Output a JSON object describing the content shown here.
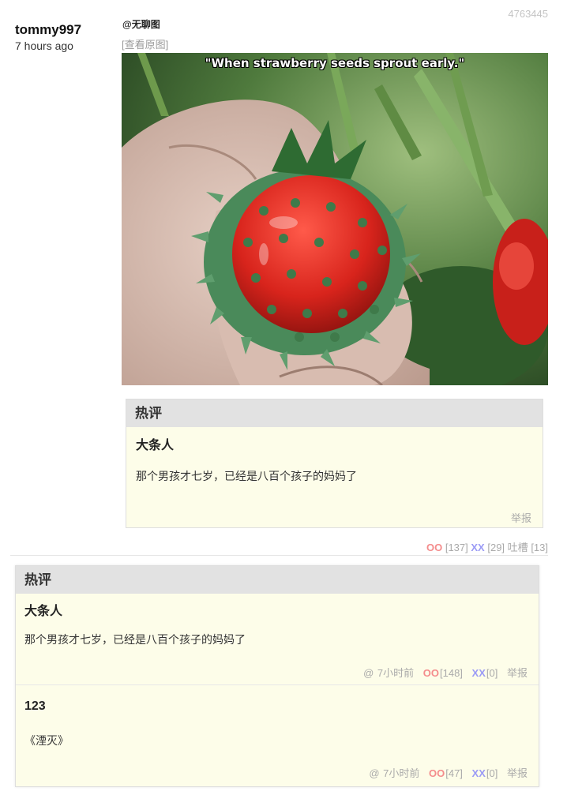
{
  "post": {
    "author": "tommy997",
    "time": "7 hours ago",
    "id": "4763445",
    "at_user": "@无聊图",
    "view_original": "[查看原图]",
    "image": {
      "caption": "\"When strawberry seeds sprout early.\"",
      "description_icon": "photo"
    },
    "hot_comment": {
      "header": "热评",
      "author": "大条人",
      "text": "那个男孩才七岁，已经是八百个孩子的妈妈了",
      "report": "举报"
    },
    "votes": {
      "oo_label": "OO",
      "oo_count": "[137]",
      "xx_label": "XX",
      "xx_count": "[29]",
      "tucao_label": "吐槽",
      "tucao_count": "[13]"
    }
  },
  "hot_section": {
    "header": "热评",
    "entries": [
      {
        "author": "大条人",
        "text": "那个男孩才七岁，已经是八百个孩子的妈妈了",
        "at": "@",
        "time": "7小时前",
        "oo_label": "OO",
        "oo_count": "[148]",
        "xx_label": "XX",
        "xx_count": "[0]",
        "report": "举报"
      },
      {
        "author": "123",
        "text": "《湮灭》",
        "at": "@",
        "time": "7小时前",
        "oo_label": "OO",
        "oo_count": "[47]",
        "xx_label": "XX",
        "xx_count": "[0]",
        "report": "举报"
      }
    ]
  },
  "colors": {
    "oo": "#f48c8c",
    "xx": "#9b9bf5",
    "hot_bg": "#fdfde9",
    "hot_head_bg": "#e2e2e2"
  }
}
